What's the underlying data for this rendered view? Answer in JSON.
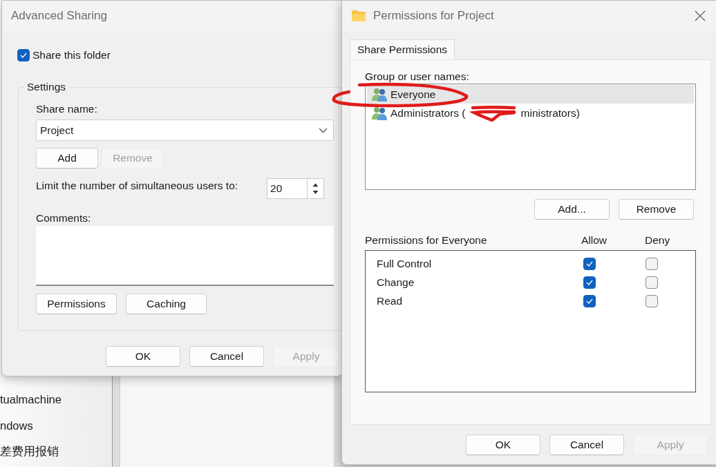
{
  "background_window": {
    "items": [
      {
        "label": "tualmachine"
      },
      {
        "label": "ndows"
      },
      {
        "label": "差费用报销"
      }
    ]
  },
  "advanced_sharing": {
    "title": "Advanced Sharing",
    "share_checkbox": {
      "label": "Share this folder",
      "checked": true
    },
    "settings": {
      "legend": "Settings",
      "share_name_label": "Share name:",
      "share_name": "Project",
      "name_buttons": [
        {
          "label": "Add",
          "disabled": false
        },
        {
          "label": "Remove",
          "disabled": true
        }
      ],
      "limit_label": "Limit the number of simultaneous users to:",
      "limit_value": "20",
      "comments_label": "Comments:",
      "extra_buttons": [
        {
          "label": "Permissions",
          "disabled": false
        },
        {
          "label": "Caching",
          "disabled": false
        }
      ]
    },
    "buttons": [
      {
        "label": "OK",
        "disabled": false
      },
      {
        "label": "Cancel",
        "disabled": false
      },
      {
        "label": "Apply",
        "disabled": true
      }
    ]
  },
  "permissions_dialog": {
    "title": "Permissions for Project",
    "tabs": [
      {
        "label": "Share Permissions",
        "selected": true
      }
    ],
    "group_label": "Group or user names:",
    "principals": [
      {
        "name": "Everyone",
        "selected": true,
        "redacted": false
      },
      {
        "name": "Administrators (",
        "redacted": true,
        "suffix": "ministrators)",
        "selected": false
      }
    ],
    "principal_buttons": [
      {
        "label": "Add...",
        "disabled": false
      },
      {
        "label": "Remove",
        "disabled": false
      }
    ],
    "permissions_label": "Permissions for Everyone",
    "columns": [
      "Allow",
      "Deny"
    ],
    "permissions": [
      {
        "name": "Full Control",
        "allow": true,
        "deny": false
      },
      {
        "name": "Change",
        "allow": true,
        "deny": false
      },
      {
        "name": "Read",
        "allow": true,
        "deny": false
      }
    ],
    "buttons": [
      {
        "label": "OK",
        "disabled": false
      },
      {
        "label": "Cancel",
        "disabled": false
      },
      {
        "label": "Apply",
        "disabled": true
      }
    ]
  },
  "annotations": [
    {
      "kind": "circle"
    }
  ]
}
